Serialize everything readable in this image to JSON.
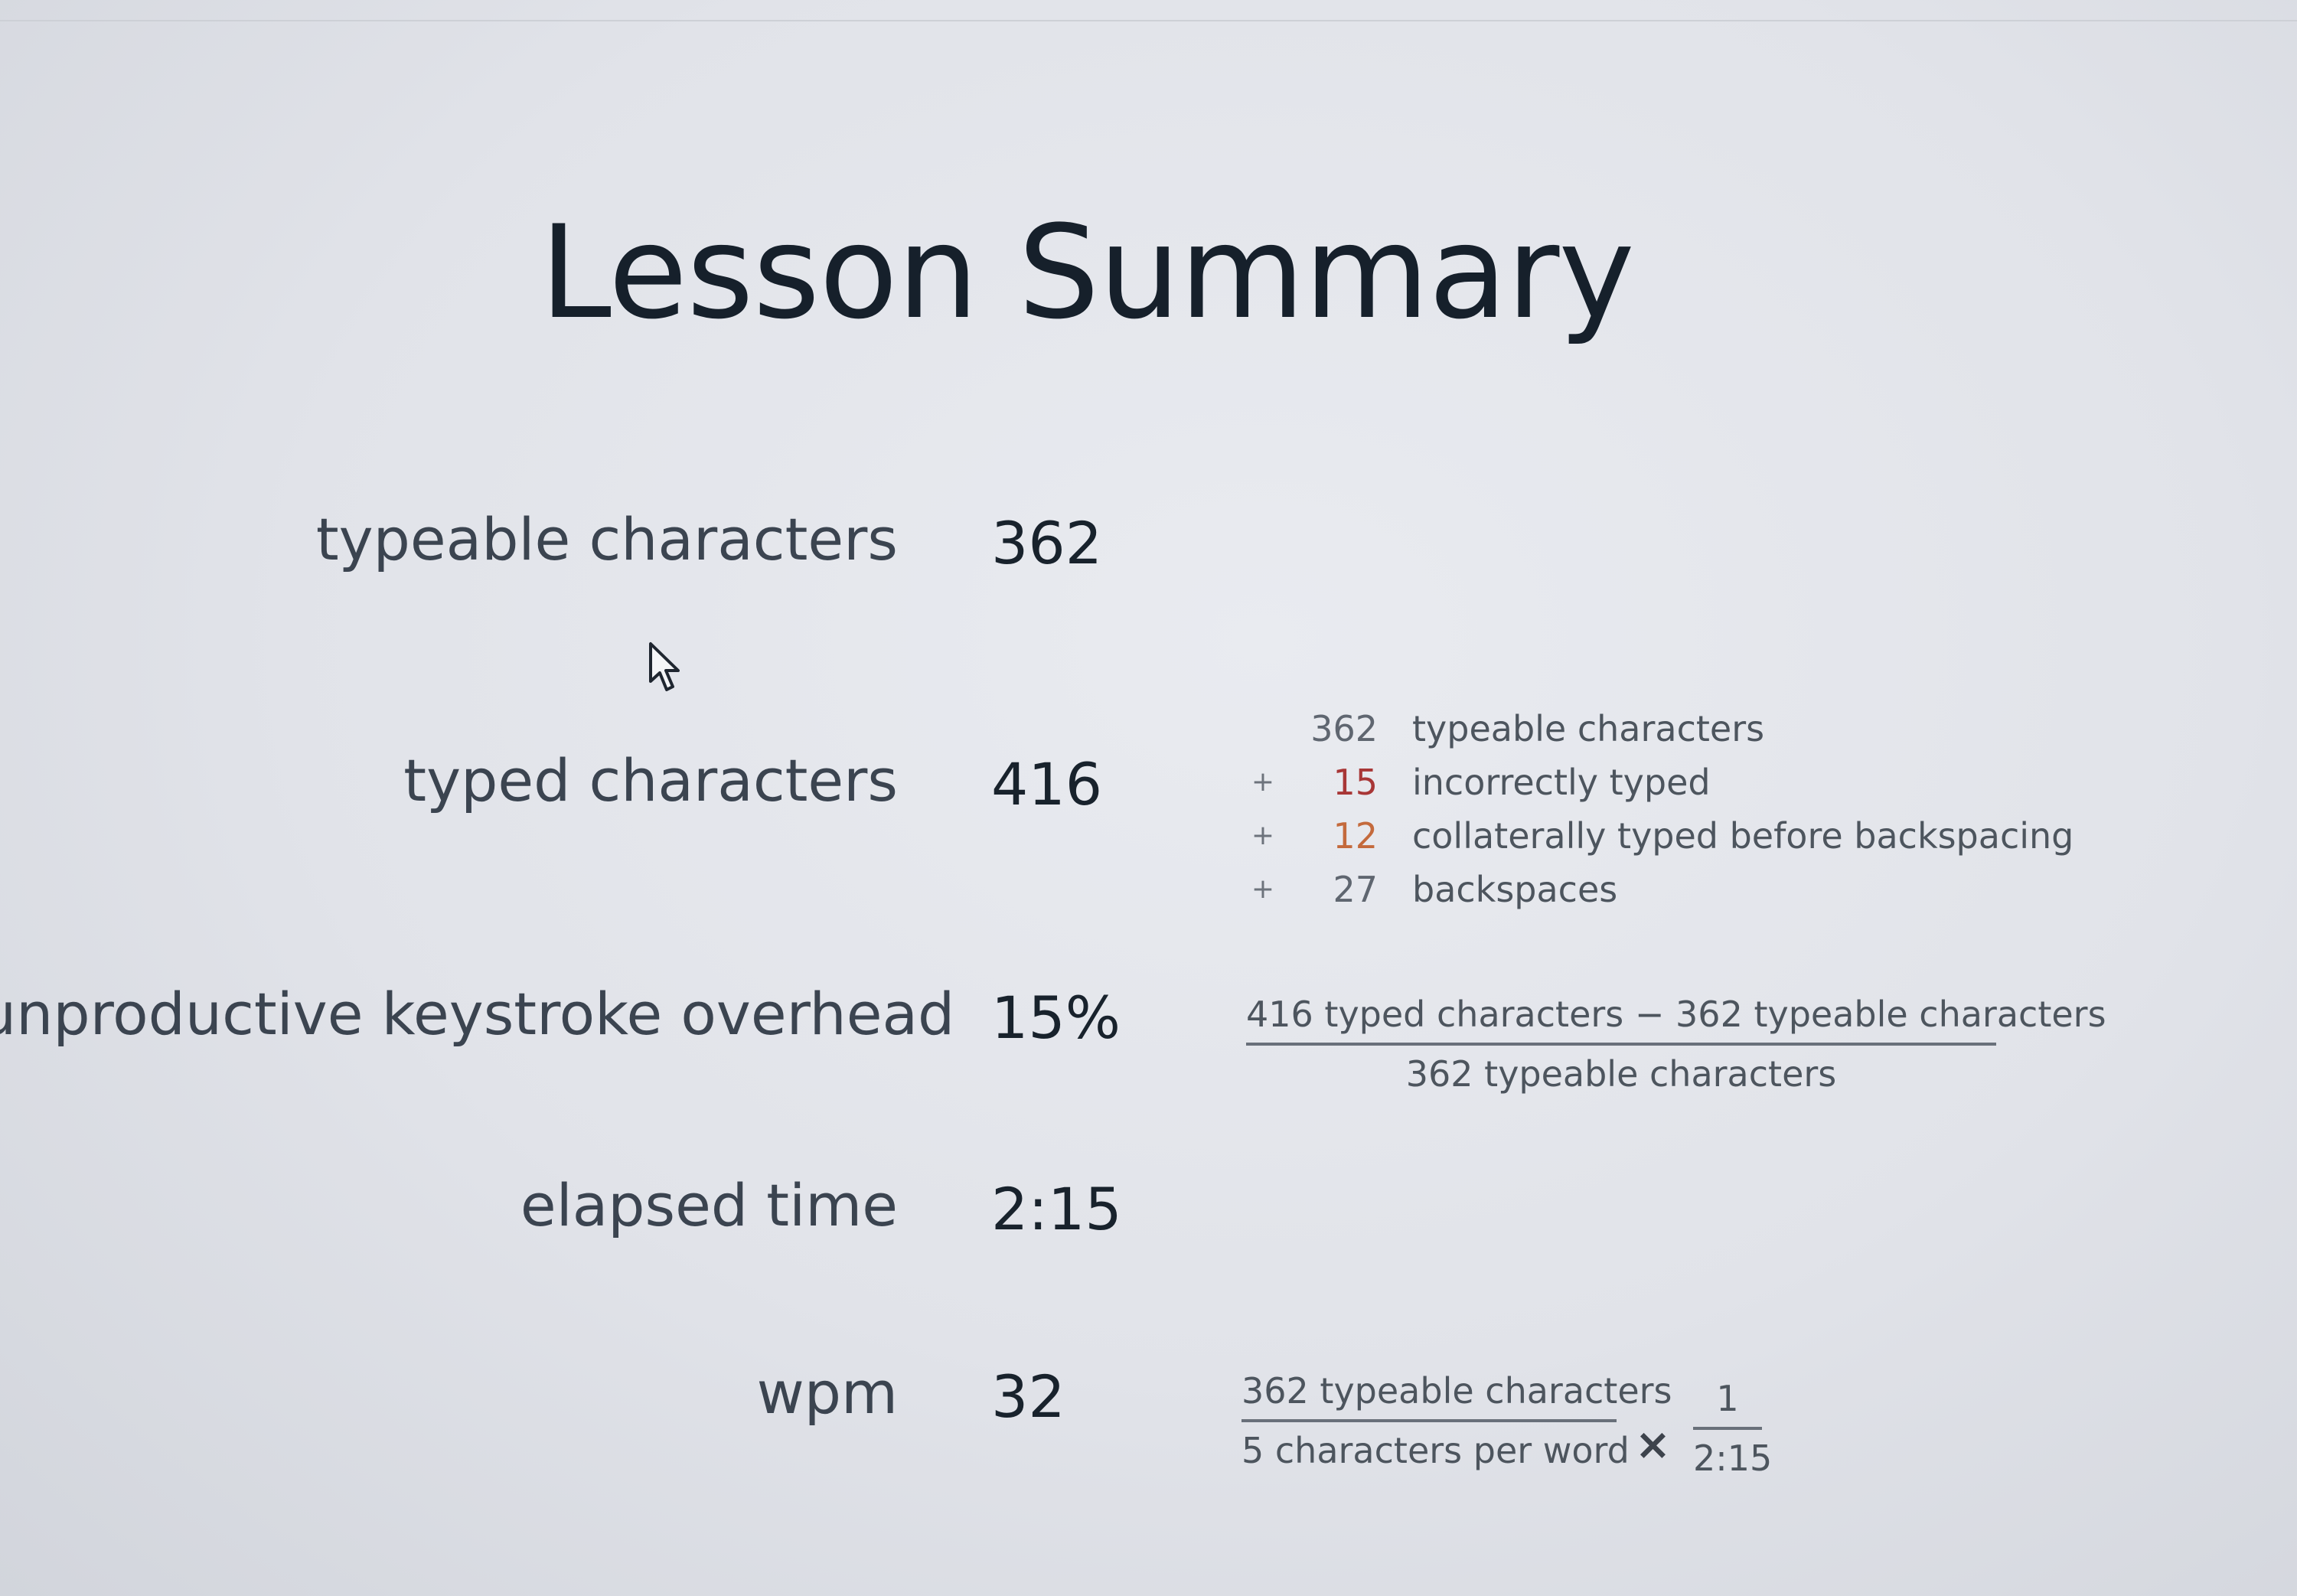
{
  "title": "Lesson Summary",
  "rows": {
    "typeable": {
      "label": "typeable characters",
      "value": "362"
    },
    "typed": {
      "label": "typed characters",
      "value": "416"
    },
    "overhead": {
      "label": "unproductive keystroke overhead",
      "value": "15%"
    },
    "elapsed": {
      "label": "elapsed time",
      "value": "2:15"
    },
    "wpm": {
      "label": "wpm",
      "value": "32"
    }
  },
  "breakdown": [
    {
      "op": "",
      "num": "362",
      "text": "typeable characters"
    },
    {
      "op": "+",
      "num": "15",
      "text": "incorrectly typed"
    },
    {
      "op": "+",
      "num": "12",
      "text": "collaterally typed before backspacing"
    },
    {
      "op": "+",
      "num": "27",
      "text": "backspaces"
    }
  ],
  "overhead_formula": {
    "numerator": "416 typed characters − 362 typeable characters",
    "denominator": "362 typeable characters"
  },
  "wpm_formula": {
    "numerator": "362 typeable characters",
    "denominator": "5 characters per word",
    "times": "×",
    "right_numerator": "1",
    "right_denominator": "2:15"
  },
  "colors": {
    "incorrect": "#a83636",
    "collateral": "#c46a3c"
  },
  "icons": {
    "cursor": "mouse-pointer-icon"
  }
}
